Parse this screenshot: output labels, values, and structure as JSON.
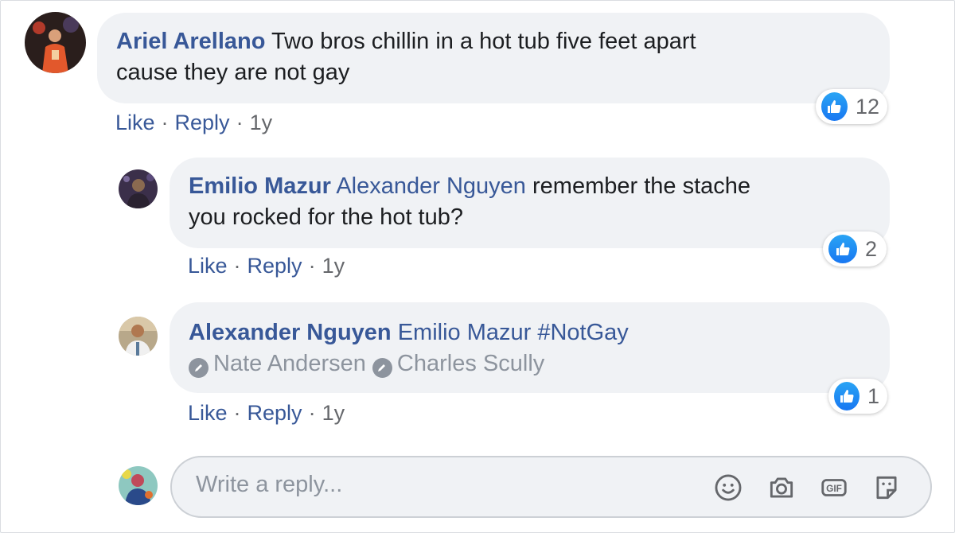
{
  "comments": [
    {
      "author": "Ariel Arellano",
      "text": "Two bros chillin in a hot tub five feet apart",
      "text_line2": "cause they are not gay",
      "like_label": "Like",
      "reply_label": "Reply",
      "time": "1y",
      "reaction_count": "12"
    },
    {
      "author": "Emilio Mazur",
      "mention": "Alexander Nguyen",
      "text": "remember the stache",
      "text_line2": "you rocked for the hot tub?",
      "like_label": "Like",
      "reply_label": "Reply",
      "time": "1y",
      "reaction_count": "2"
    },
    {
      "author": "Alexander Nguyen",
      "mention": "Emilio Mazur",
      "hashtag": "#NotGay",
      "tags": [
        "Nate Andersen",
        "Charles Scully"
      ],
      "like_label": "Like",
      "reply_label": "Reply",
      "time": "1y",
      "reaction_count": "1"
    }
  ],
  "composer": {
    "placeholder": "Write a reply...",
    "icons": [
      "emoji-icon",
      "camera-icon",
      "gif-icon",
      "sticker-icon"
    ]
  },
  "colors": {
    "name_link": "#385898",
    "bubble_bg": "#f0f2f5",
    "like_blue": "#1877f2",
    "meta_gray": "#65676b"
  },
  "separator": "·"
}
